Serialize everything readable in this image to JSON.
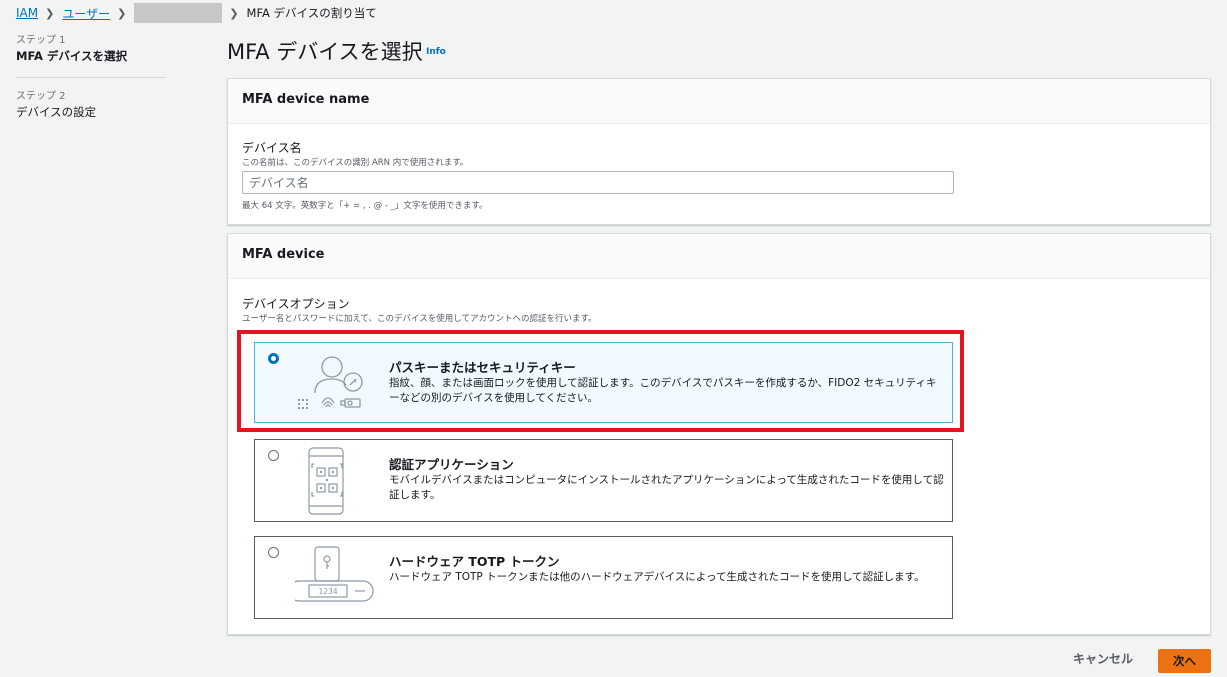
{
  "breadcrumb": {
    "items": [
      "IAM",
      "ユーザー"
    ],
    "current": "MFA デバイスの割り当て"
  },
  "steps": [
    {
      "caption": "ステップ 1",
      "title": "MFA デバイスを選択"
    },
    {
      "caption": "ステップ 2",
      "title": "デバイスの設定"
    }
  ],
  "page": {
    "title": "MFA デバイスを選択",
    "info": "Info"
  },
  "name_panel": {
    "header": "MFA device name",
    "label": "デバイス名",
    "description": "この名前は、このデバイスの識別 ARN 内で使用されます。",
    "placeholder": "デバイス名",
    "constraint": "最大 64 文字。英数字と「+ = , . @ - _」文字を使用できます。"
  },
  "device_panel": {
    "header": "MFA device",
    "label": "デバイスオプション",
    "description": "ユーザー名とパスワードに加えて、このデバイスを使用してアカウントへの認証を行います。",
    "options": [
      {
        "title": "パスキーまたはセキュリティキー",
        "description": "指紋、顔、または画面ロックを使用して認証します。このデバイスでパスキーを作成するか、FIDO2 セキュリティキーなどの別のデバイスを使用してください。",
        "icon": "passkey-icon",
        "selected": true
      },
      {
        "title": "認証アプリケーション",
        "description": "モバイルデバイスまたはコンピュータにインストールされたアプリケーションによって生成されたコードを使用して認証します。",
        "icon": "authenticator-app-icon",
        "selected": false
      },
      {
        "title": "ハードウェア TOTP トークン",
        "description": "ハードウェア TOTP トークンまたは他のハードウェアデバイスによって生成されたコードを使用して認証します。",
        "icon": "hardware-token-icon",
        "token_display": "1234",
        "selected": false
      }
    ]
  },
  "footer": {
    "cancel": "キャンセル",
    "next": "次へ"
  },
  "colors": {
    "link": "#0073bb",
    "primary_button": "#ec7211",
    "selected_border": "#44b9d6",
    "highlight": "#e3141e"
  }
}
